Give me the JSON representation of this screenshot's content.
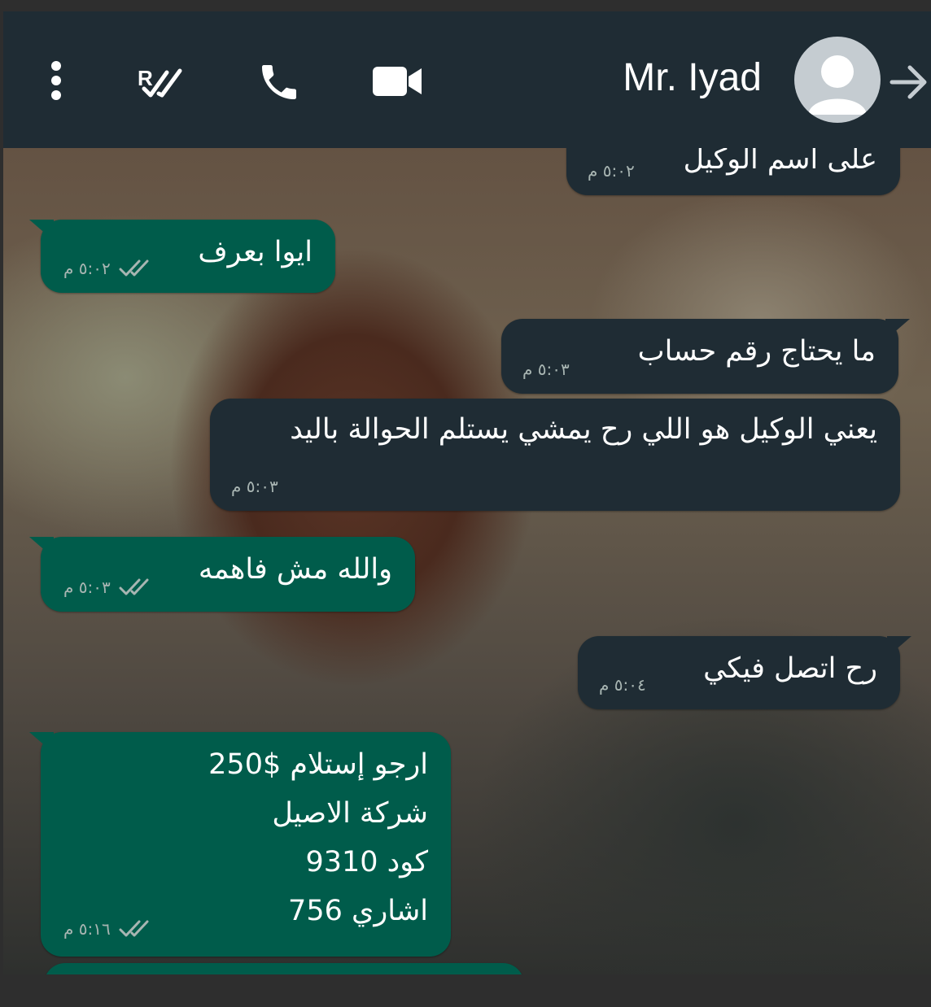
{
  "header": {
    "contact_name": "Mr. Iyad",
    "icons": [
      "more-vert-icon",
      "mark-read-icon",
      "phone-icon",
      "video-call-icon",
      "avatar-icon",
      "forward-arrow-icon"
    ]
  },
  "messages": [
    {
      "direction": "incoming",
      "text": "على اسم الوكيل",
      "time": "٥:٠٢ م"
    },
    {
      "direction": "outgoing",
      "text": "ايوا بعرف",
      "time": "٥:٠٢ م",
      "read": true
    },
    {
      "direction": "incoming",
      "text": "ما يحتاج رقم حساب",
      "time": "٥:٠٣ م"
    },
    {
      "direction": "incoming",
      "text": "يعني الوكيل هو اللي رح يمشي يستلم الحوالة باليد",
      "time": "٥:٠٣ م"
    },
    {
      "direction": "outgoing",
      "text": "والله مش فاهمه",
      "time": "٥:٠٣ م",
      "read": true
    },
    {
      "direction": "incoming",
      "text": "رح اتصل فيكي",
      "time": "٥:٠٤ م"
    },
    {
      "direction": "outgoing",
      "lines": [
        "ارجو إستلام $250",
        "شركة الاصيل",
        "كود 9310",
        "اشاري 756"
      ],
      "time": "٥:١٦ م",
      "read": true
    }
  ],
  "colors": {
    "header_bg": "#1f2c34",
    "incoming_bubble": "#1f2c34",
    "outgoing_bubble": "#005c4b",
    "read_ticks": "#a8b5b2"
  }
}
